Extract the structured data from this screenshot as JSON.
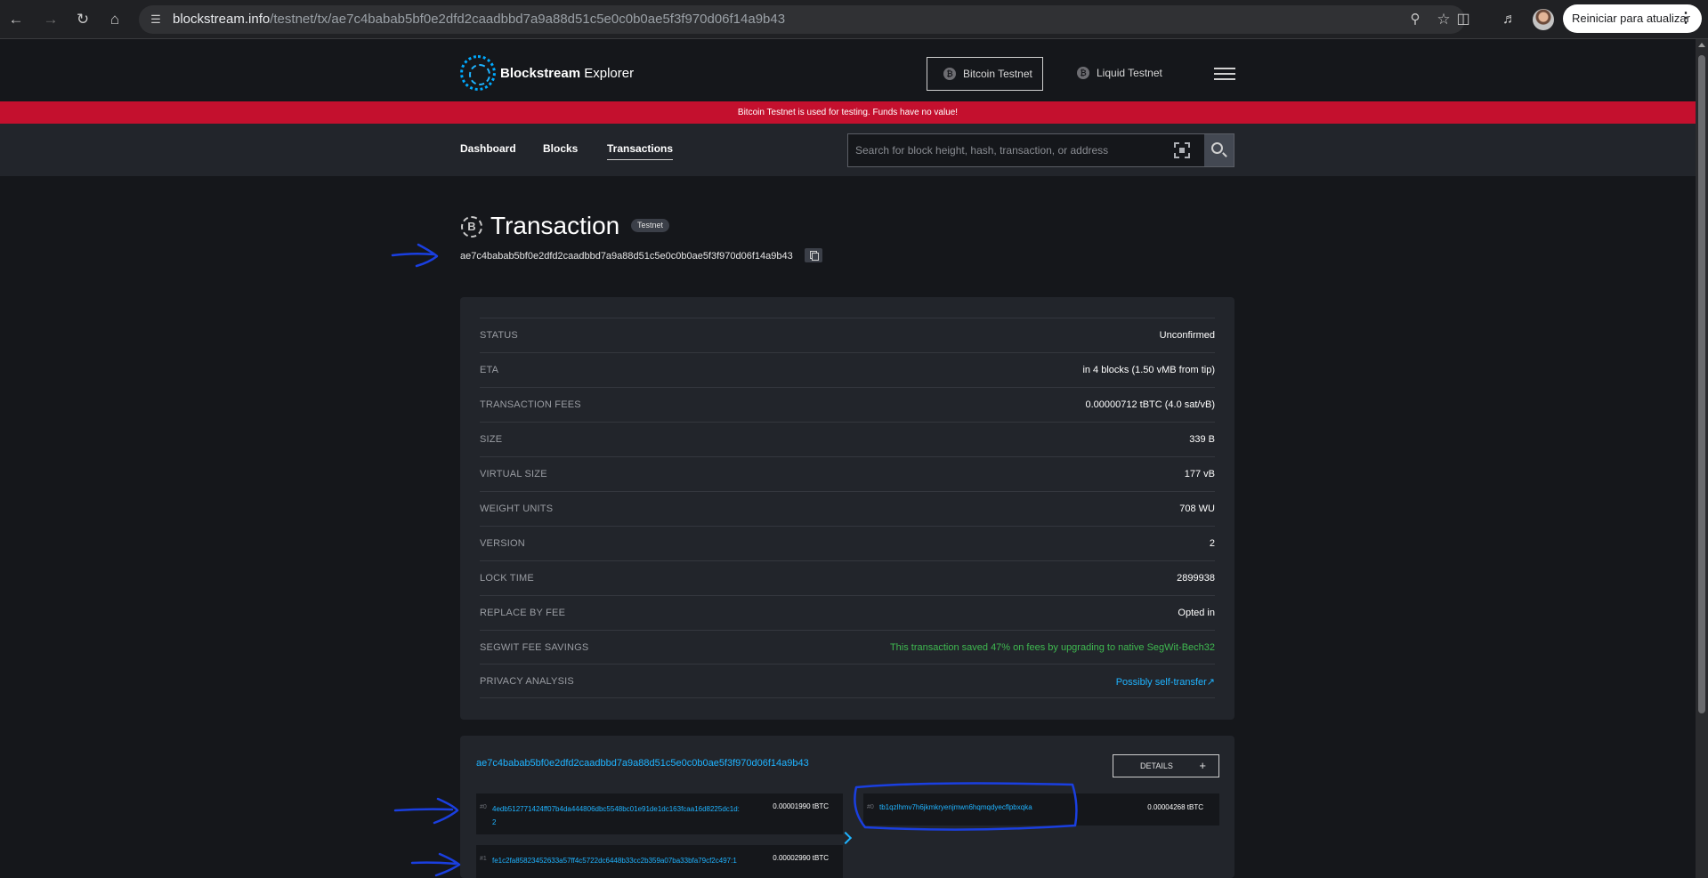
{
  "browser": {
    "url_host": "blockstream.info",
    "url_path": "/testnet/tx/ae7c4babab5bf0e2dfd2caadbbd7a9a88d51c5e0c0b0ae5f3f970d06f14a9b43",
    "update_button_label": "Reiniciar para atualizar"
  },
  "header": {
    "logo_bold": "Blockstream",
    "logo_light": "Explorer",
    "networks": [
      {
        "label": "Bitcoin Testnet",
        "active": true
      },
      {
        "label": "Liquid Testnet",
        "active": false
      }
    ]
  },
  "warning": "Bitcoin Testnet is used for testing. Funds have no value!",
  "subnav": {
    "tabs": [
      "Dashboard",
      "Blocks",
      "Transactions"
    ],
    "active_tab": "Transactions",
    "search_placeholder": "Search for block height, hash, transaction, or address"
  },
  "transaction": {
    "title": "Transaction",
    "badge": "Testnet",
    "txid": "ae7c4babab5bf0e2dfd2caadbbd7a9a88d51c5e0c0b0ae5f3f970d06f14a9b43",
    "details": [
      {
        "label": "STATUS",
        "value": "Unconfirmed"
      },
      {
        "label": "ETA",
        "value": "in 4 blocks (1.50 vMB from tip)"
      },
      {
        "label": "TRANSACTION FEES",
        "value": "0.00000712 tBTC (4.0 sat/vB)"
      },
      {
        "label": "SIZE",
        "value": "339 B"
      },
      {
        "label": "VIRTUAL SIZE",
        "value": "177 vB"
      },
      {
        "label": "WEIGHT UNITS",
        "value": "708 WU"
      },
      {
        "label": "VERSION",
        "value": "2"
      },
      {
        "label": "LOCK TIME",
        "value": "2899938"
      },
      {
        "label": "REPLACE BY FEE",
        "value": "Opted in"
      },
      {
        "label": "SEGWIT FEE SAVINGS",
        "value": "This transaction saved 47% on fees by upgrading to native SegWit-Bech32"
      },
      {
        "label": "PRIVACY ANALYSIS",
        "value": "Possibly self-transfer↗"
      }
    ]
  },
  "io": {
    "txid": "ae7c4babab5bf0e2dfd2caadbbd7a9a88d51c5e0c0b0ae5f3f970d06f14a9b43",
    "details_label": "DETAILS",
    "details_plus": "+",
    "inputs": [
      {
        "index": "#0",
        "address": "4edb512771424ff07b4da444806dbc5548bc01e91de1dc163fcaa16d8225dc1d:2",
        "amount": "0.00001990 tBTC"
      },
      {
        "index": "#1",
        "address": "fe1c2fa85823452633a57ff4c5722dc6448b33cc2b359a07ba33bfa79cf2c497:1",
        "amount": "0.00002990 tBTC"
      }
    ],
    "outputs": [
      {
        "index": "#0",
        "address": "tb1qzlhmv7h6jkmkryenjmwn6hqmqdyecflpbxqka",
        "amount": "0.00004268 tBTC"
      }
    ]
  },
  "colors": {
    "accent": "#1fb3ff",
    "warning": "#c4102e",
    "success": "#3fb950",
    "annotation": "#1a3fe0"
  }
}
